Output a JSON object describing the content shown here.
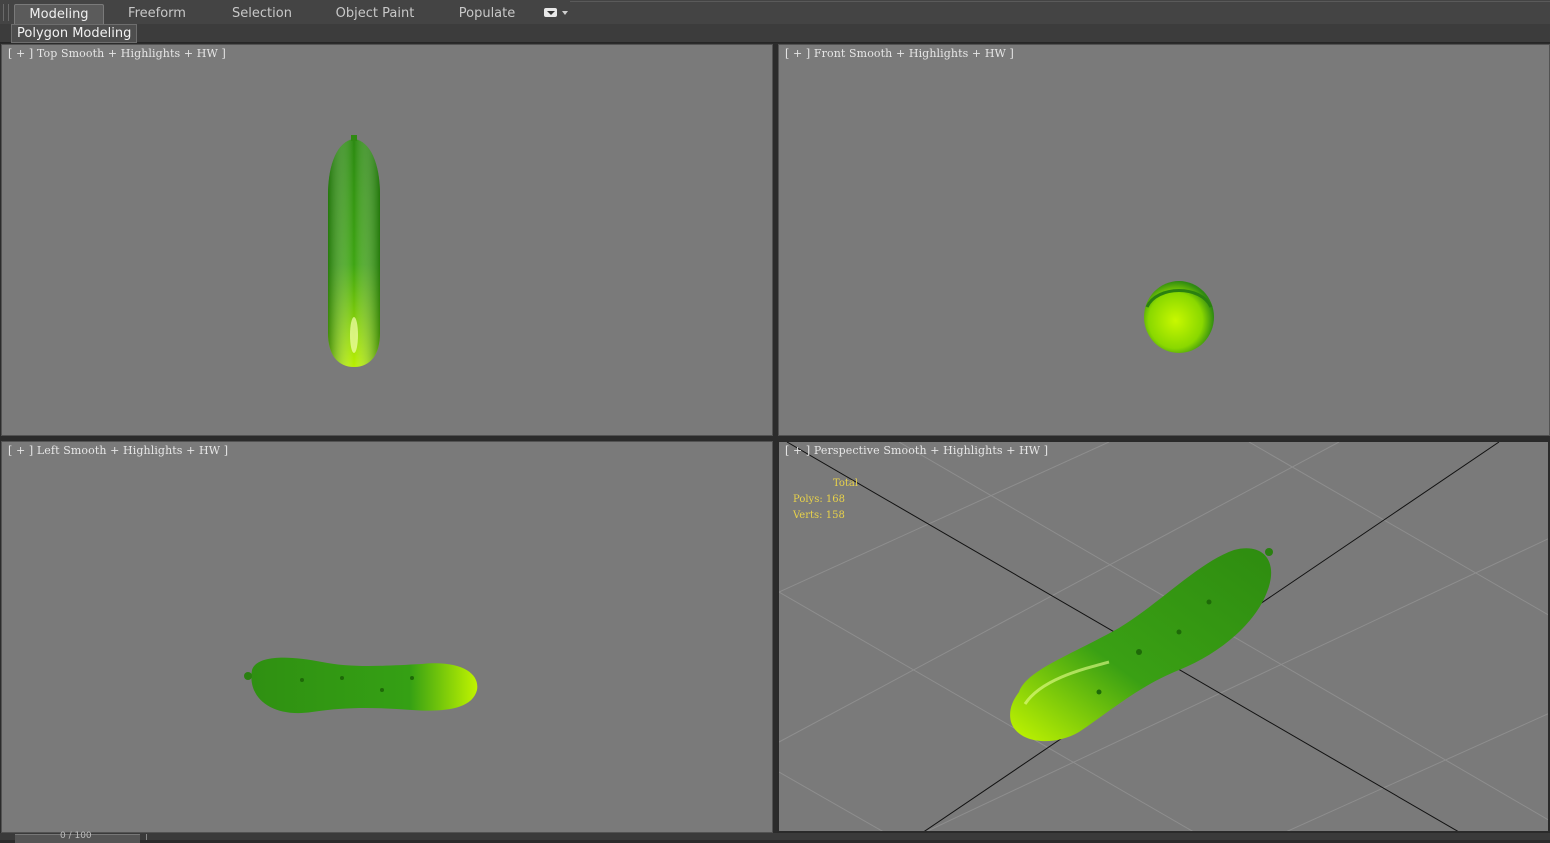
{
  "ribbon": {
    "tabs": [
      {
        "label": "Modeling",
        "active": true
      },
      {
        "label": "Freeform",
        "active": false
      },
      {
        "label": "Selection",
        "active": false
      },
      {
        "label": "Object Paint",
        "active": false
      },
      {
        "label": "Populate",
        "active": false
      }
    ],
    "more_icon": "ribbon-options-icon",
    "panel_label": "Polygon Modeling"
  },
  "viewports": {
    "top": {
      "menu": "[ + ]",
      "view": "Top",
      "shading": "Smooth + Highlights + HW ]"
    },
    "front": {
      "menu": "[ + ]",
      "view": "Front",
      "shading": "Smooth + Highlights + HW ]"
    },
    "left": {
      "menu": "[ + ]",
      "view": "Left",
      "shading": "Smooth + Highlights + HW ]"
    },
    "perspective": {
      "menu": "[ + ]",
      "view": "Perspective",
      "shading": "Smooth + Highlights + HW ]"
    }
  },
  "stats": {
    "header": "Total",
    "polys_label": "Polys:",
    "polys_value": "168",
    "verts_label": "Verts:",
    "verts_value": "158"
  },
  "timeline": {
    "frame": "0 / 100"
  },
  "colors": {
    "viewport_bg": "#7a7a7a",
    "object_dark": "#2f8a12",
    "object_light": "#b4f000",
    "stats_text": "#e8d24a"
  }
}
